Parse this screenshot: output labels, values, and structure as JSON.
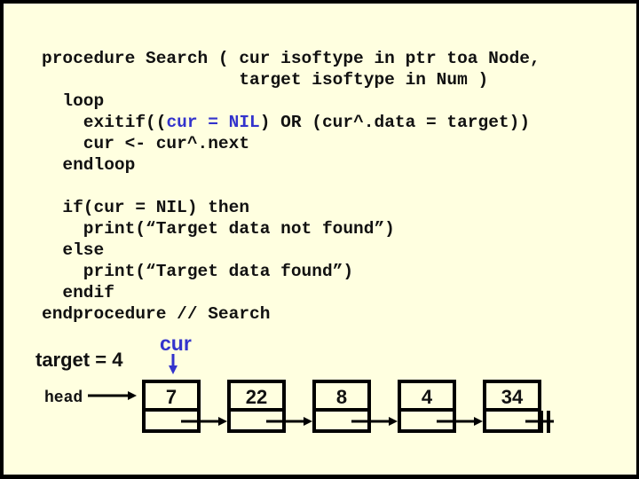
{
  "code": {
    "lines": [
      {
        "indent": "",
        "parts": [
          {
            "t": "procedure Search ( cur isoftype in ptr toa Node,"
          }
        ]
      },
      {
        "indent": "",
        "parts": [
          {
            "t": "                   target isoftype in Num )"
          }
        ]
      },
      {
        "indent": "",
        "parts": [
          {
            "t": "  loop"
          }
        ]
      },
      {
        "indent": "",
        "parts": [
          {
            "t": "    exitif(("
          },
          {
            "t": "cur = NIL",
            "hl": true
          },
          {
            "t": ") OR (cur^.data = target))"
          }
        ]
      },
      {
        "indent": "",
        "parts": [
          {
            "t": "    cur <- cur^.next"
          }
        ]
      },
      {
        "indent": "",
        "parts": [
          {
            "t": "  endloop"
          }
        ]
      },
      {
        "blank": true
      },
      {
        "indent": "",
        "parts": [
          {
            "t": "  if(cur = NIL) then"
          }
        ]
      },
      {
        "indent": "",
        "parts": [
          {
            "t": "    print(“Target data not found”)"
          }
        ]
      },
      {
        "indent": "",
        "parts": [
          {
            "t": "  else"
          }
        ]
      },
      {
        "indent": "",
        "parts": [
          {
            "t": "    print(“Target data found”)"
          }
        ]
      },
      {
        "indent": "",
        "parts": [
          {
            "t": "  endif"
          }
        ]
      },
      {
        "indent": "",
        "parts": [
          {
            "t": "endprocedure // Search"
          }
        ]
      }
    ]
  },
  "diagram": {
    "target_label": "target = 4",
    "cur_label": "cur",
    "head_label": "head",
    "cur_points_to_index": 0,
    "nodes": [
      {
        "value": "7"
      },
      {
        "value": "22"
      },
      {
        "value": "8"
      },
      {
        "value": "4"
      },
      {
        "value": "34"
      }
    ],
    "last_next": "NIL"
  },
  "colors": {
    "background": "#ffffe0",
    "border": "#000000",
    "highlight": "#3333cc",
    "text": "#111111"
  }
}
